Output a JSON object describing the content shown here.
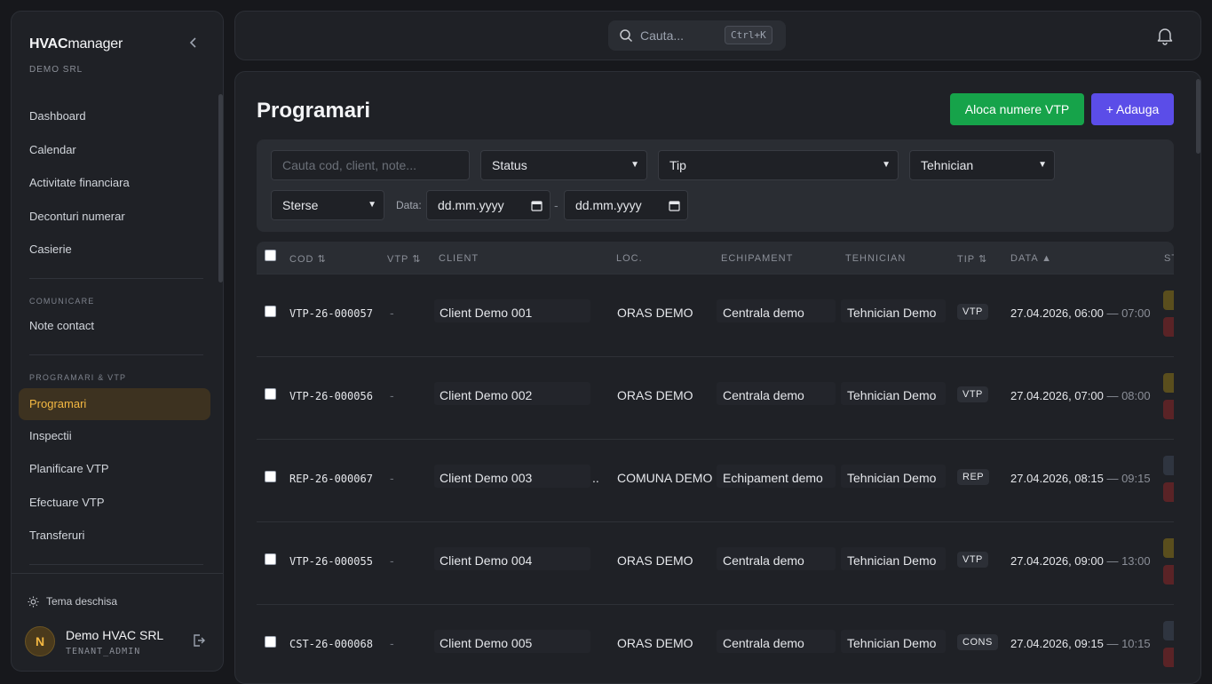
{
  "sidebar": {
    "logo_bold": "HVAC",
    "logo_light": "manager",
    "tenant": "DEMO SRL",
    "items_main": [
      "Dashboard",
      "Calendar",
      "Activitate financiara",
      "Deconturi numerar",
      "Casierie"
    ],
    "section_comunicare": "COMUNICARE",
    "items_comunicare": [
      "Note contact"
    ],
    "section_programari": "PROGRAMARI & VTP",
    "items_programari": [
      "Programari",
      "Inspectii",
      "Planificare VTP",
      "Efectuare VTP",
      "Transferuri"
    ],
    "active_item": "Programari",
    "theme_label": "Tema deschisa",
    "user": {
      "initial": "N",
      "name": "Demo HVAC SRL",
      "role": "TENANT_ADMIN"
    }
  },
  "topbar": {
    "search_placeholder": "Cauta...",
    "shortcut": "Ctrl+K"
  },
  "page": {
    "title": "Programari",
    "btn_aloca": "Aloca numere VTP",
    "btn_add": "+ Adauga"
  },
  "filters": {
    "search_placeholder": "Cauta cod, client, note...",
    "status": "Status",
    "tip": "Tip",
    "tehnician": "Tehnician",
    "sterse": "Sterse",
    "data_label": "Data:",
    "date_from": "dd.mm.yyyy",
    "date_sep": "-",
    "date_to": "dd.mm.yyyy"
  },
  "table": {
    "headers": {
      "cod": "COD ⇅",
      "vtp": "VTP ⇅",
      "client": "CLIENT",
      "loc": "LOC.",
      "echipament": "ECHIPAMENT",
      "tehnician": "TEHNICIAN",
      "tip": "TIP ⇅",
      "data": "DATA ▲",
      "status": "ST"
    },
    "rows": [
      {
        "cod": "VTP-26-000057",
        "vtp": "-",
        "client": "Client Demo 001",
        "client_suffix": "",
        "loc": "ORAS DEMO",
        "echipament": "Centrala demo",
        "tehnician": "Tehnician Demo",
        "tip": "VTP",
        "start": "27.04.2026, 06:00",
        "end": "— 07:00",
        "status_colors": [
          "#5a4e1d",
          "#5a2326"
        ]
      },
      {
        "cod": "VTP-26-000056",
        "vtp": "-",
        "client": "Client Demo 002",
        "client_suffix": "",
        "loc": "ORAS DEMO",
        "echipament": "Centrala demo",
        "tehnician": "Tehnician Demo",
        "tip": "VTP",
        "start": "27.04.2026, 07:00",
        "end": "— 08:00",
        "status_colors": [
          "#5a4e1d",
          "#5a2326"
        ]
      },
      {
        "cod": "REP-26-000067",
        "vtp": "-",
        "client": "Client Demo 003",
        "client_suffix": "..",
        "loc": "COMUNA DEMO",
        "echipament": "Echipament demo",
        "tehnician": "Tehnician Demo",
        "tip": "REP",
        "start": "27.04.2026, 08:15",
        "end": "— 09:15",
        "status_colors": [
          "#2f3540",
          "#5a2326"
        ]
      },
      {
        "cod": "VTP-26-000055",
        "vtp": "-",
        "client": "Client Demo 004",
        "client_suffix": "",
        "loc": "ORAS DEMO",
        "echipament": "Centrala demo",
        "tehnician": "Tehnician Demo",
        "tip": "VTP",
        "start": "27.04.2026, 09:00",
        "end": "— 13:00",
        "status_colors": [
          "#5a4e1d",
          "#5a2326"
        ]
      },
      {
        "cod": "CST-26-000068",
        "vtp": "-",
        "client": "Client Demo 005",
        "client_suffix": "",
        "loc": "ORAS DEMO",
        "echipament": "Centrala demo",
        "tehnician": "Tehnician Demo",
        "tip": "CONS",
        "start": "27.04.2026, 09:15",
        "end": "— 10:15",
        "status_colors": [
          "#2f3540",
          "#5a2326"
        ]
      }
    ]
  },
  "icons": {
    "search": "search-icon",
    "bell": "bell-icon",
    "collapse": "chevron-left-icon",
    "theme": "sun-icon",
    "logout": "logout-icon",
    "calendar": "calendar-icon"
  },
  "colors": {
    "accent_active": "#f5b942",
    "btn_green": "#16a34a",
    "btn_purple": "#5b4de8"
  }
}
